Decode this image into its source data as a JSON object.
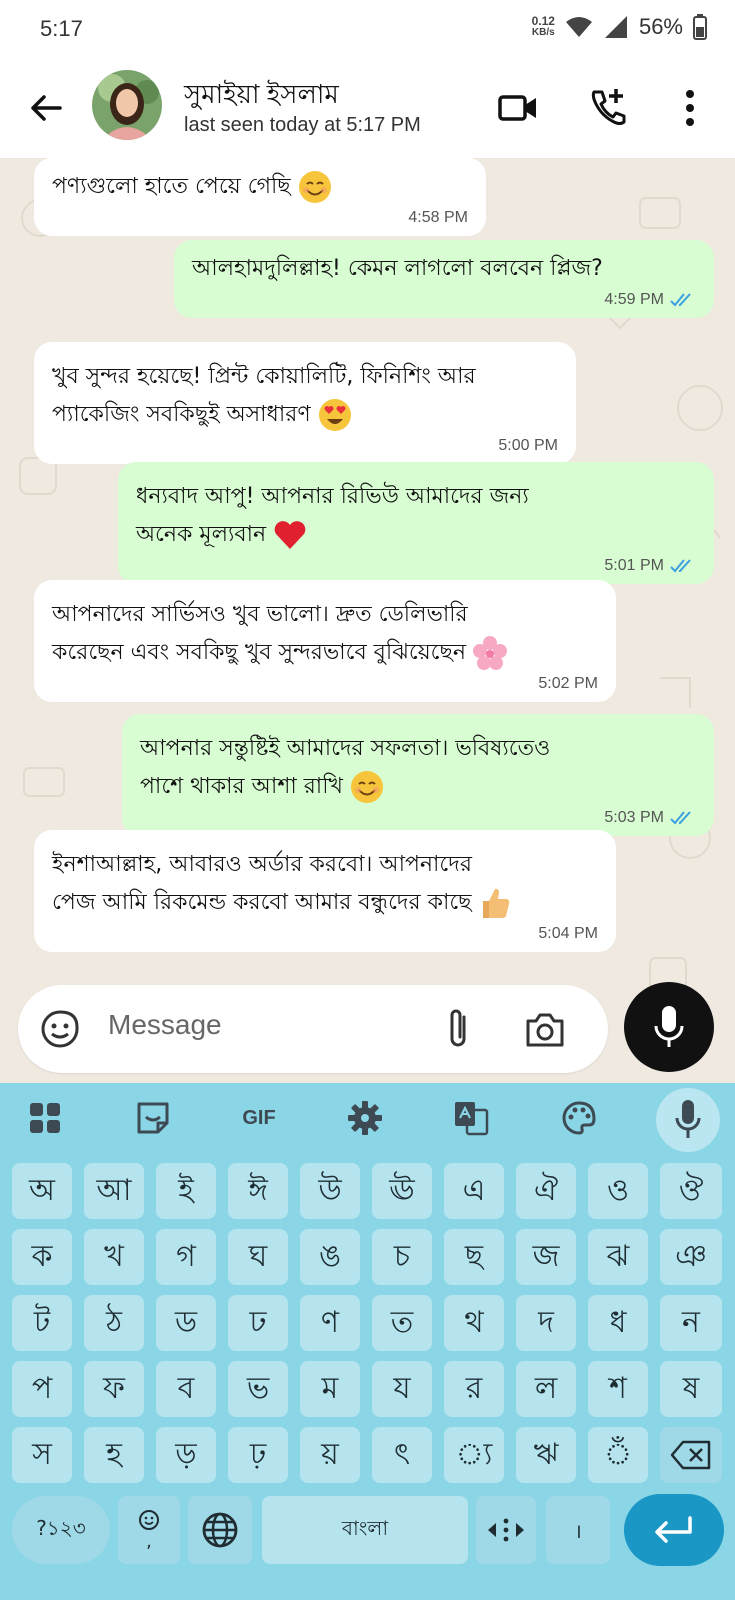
{
  "status_bar": {
    "time": "5:17",
    "net_speed_value": "0.12",
    "net_speed_unit": "KB/s",
    "battery": "56%"
  },
  "header": {
    "contact_name": "সুমাইয়া ইসলাম",
    "last_seen": "last seen today at 5:17 PM",
    "icons": [
      "back-arrow-icon",
      "video-call-icon",
      "add-call-icon",
      "more-vertical-icon"
    ]
  },
  "messages": [
    {
      "direction": "in",
      "lines": [
        "পণ্যগুলো হাতে পেয়ে গেছি"
      ],
      "emoji": "smile",
      "time": "4:58 PM"
    },
    {
      "direction": "out",
      "lines": [
        "আলহামদুলিল্লাহ! কেমন লাগলো বলবেন প্লিজ?"
      ],
      "emoji": "",
      "time": "4:59 PM",
      "read": true
    },
    {
      "direction": "in",
      "lines": [
        "খুব সুন্দর হয়েছে! প্রিন্ট কোয়ালিটি, ফিনিশিং আর",
        "প্যাকেজিং সবকিছুই অসাধারণ"
      ],
      "emoji": "heart-eyes",
      "time": "5:00 PM"
    },
    {
      "direction": "out",
      "lines": [
        "ধন্যবাদ আপু! আপনার রিভিউ আমাদের জন্য",
        "অনেক মূল্যবান"
      ],
      "emoji": "red-heart",
      "time": "5:01 PM",
      "read": true
    },
    {
      "direction": "in",
      "lines": [
        "আপনাদের সার্ভিসও খুব ভালো। দ্রুত ডেলিভারি",
        "করেছেন এবং সবকিছু খুব সুন্দরভাবে বুঝিয়েছেন"
      ],
      "emoji": "cherry-blossom",
      "time": "5:02 PM"
    },
    {
      "direction": "out",
      "lines": [
        "আপনার সন্তুষ্টিই আমাদের সফলতা। ভবিষ্যতেও",
        "পাশে থাকার আশা রাখি"
      ],
      "emoji": "smile",
      "time": "5:03 PM",
      "read": true
    },
    {
      "direction": "in",
      "lines": [
        "ইনশাআল্লাহ, আবারও অর্ডার করবো। আপনাদের",
        "পেজ আমি রিকমেন্ড করবো আমার বন্ধুদের কাছে"
      ],
      "emoji": "thumbs-up",
      "time": "5:04 PM"
    }
  ],
  "input": {
    "placeholder": "Message",
    "icons": [
      "sticker-icon",
      "attach-icon",
      "camera-icon",
      "mic-icon"
    ]
  },
  "keyboard": {
    "toolbar": [
      "apps-grid-icon",
      "sticker-icon",
      "GIF",
      "settings-icon",
      "translate-icon",
      "palette-icon",
      "mic-icon"
    ],
    "gif_label": "GIF",
    "rows": [
      [
        "অ",
        "আ",
        "ই",
        "ঈ",
        "উ",
        "ঊ",
        "এ",
        "ঐ",
        "ও",
        "ঔ"
      ],
      [
        "ক",
        "খ",
        "গ",
        "ঘ",
        "ঙ",
        "চ",
        "ছ",
        "জ",
        "ঝ",
        "ঞ"
      ],
      [
        "ট",
        "ঠ",
        "ড",
        "ঢ",
        "ণ",
        "ত",
        "থ",
        "দ",
        "ধ",
        "ন"
      ],
      [
        "প",
        "ফ",
        "ব",
        "ভ",
        "ম",
        "য",
        "র",
        "ল",
        "শ",
        "ষ"
      ],
      [
        "স",
        "হ",
        "ড়",
        "ঢ়",
        "য়",
        "ৎ",
        "্য",
        "ঋ",
        "ঁ"
      ]
    ],
    "bottom_row": {
      "symbols": "?১২৩",
      "emoji_comma": ",",
      "space": "বাংলা",
      "period": "।"
    }
  },
  "colors": {
    "chat_bg": "#efe9e0",
    "incoming_bubble": "#ffffff",
    "outgoing_bubble": "#d8fdd2",
    "read_tick": "#3aa0e0",
    "keyboard_bg": "#8bd6e6",
    "key_bg": "#b5e4ee",
    "enter_key": "#1a97c4"
  }
}
